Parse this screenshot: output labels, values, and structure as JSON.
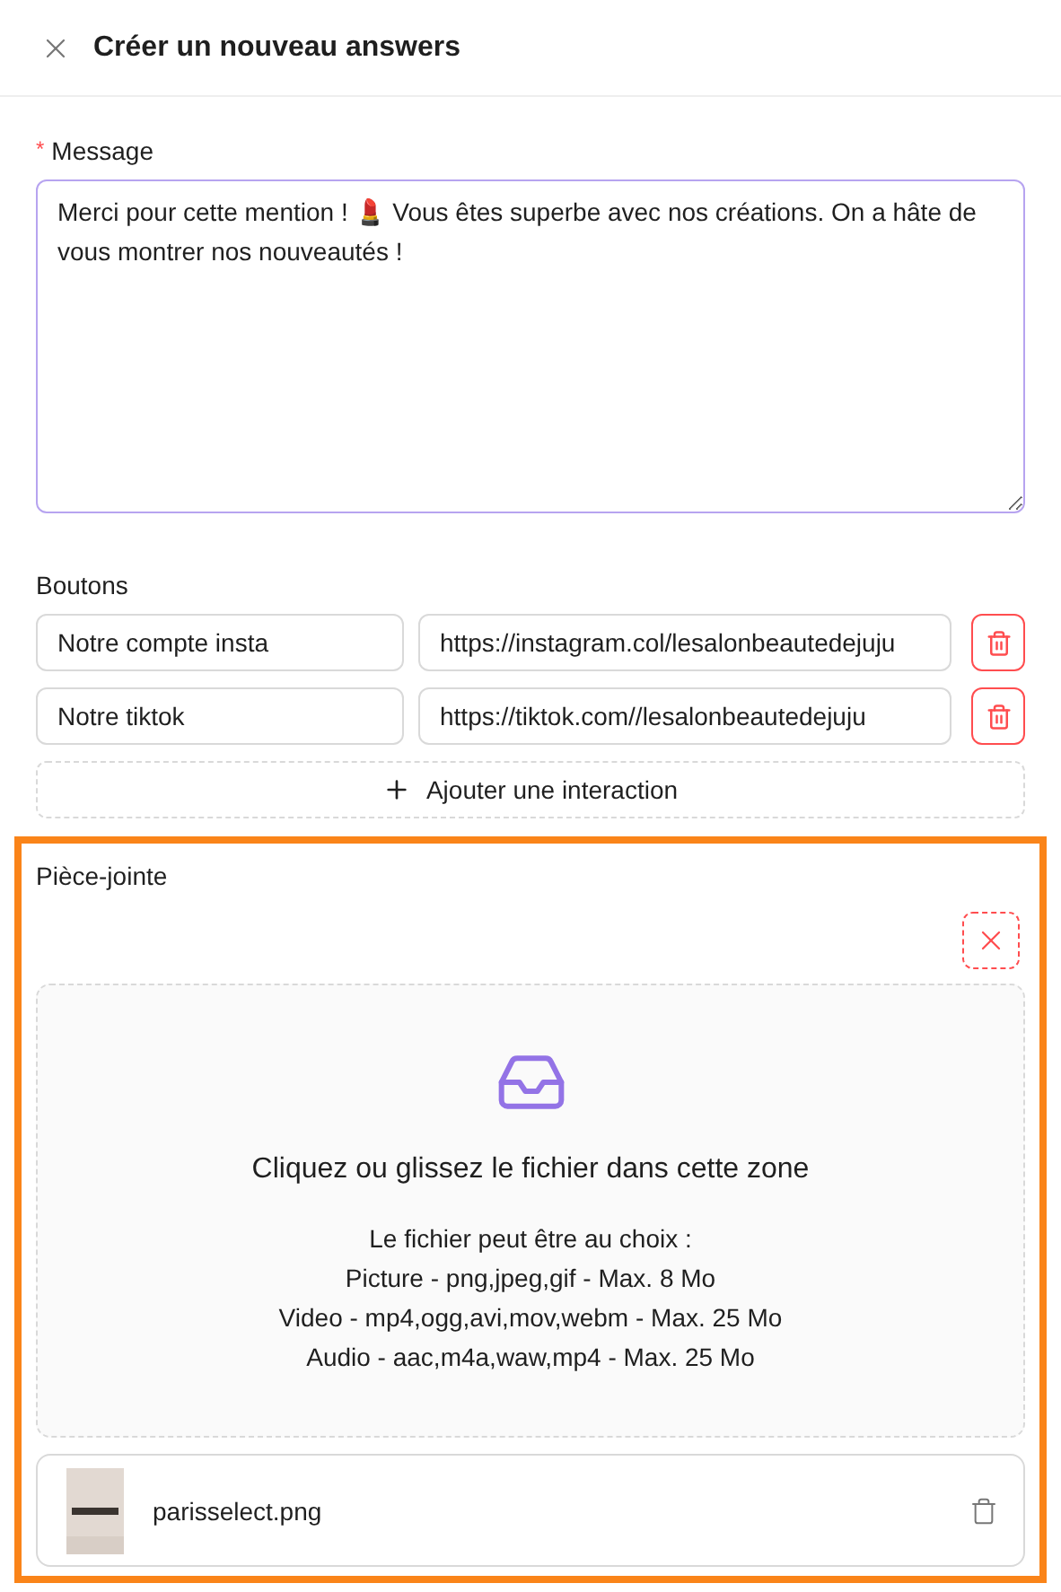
{
  "header": {
    "title": "Créer un nouveau answers"
  },
  "message": {
    "label": "Message",
    "required": true,
    "required_mark": "*",
    "value": "Merci pour cette mention ! 💄 Vous êtes superbe avec nos créations. On a hâte de vous montrer nos nouveautés !"
  },
  "buttons": {
    "label": "Boutons",
    "rows": [
      {
        "name": "Notre compte insta",
        "url": "https://instagram.col/lesalonbeautedejuju"
      },
      {
        "name": "Notre tiktok",
        "url": "https://tiktok.com//lesalonbeautedejuju"
      }
    ],
    "add_label": "Ajouter une interaction"
  },
  "attachment": {
    "label": "Pièce-jointe",
    "highlighted": true,
    "dropzone": {
      "title": "Cliquez ou glissez le fichier dans cette zone",
      "lines": [
        "Le fichier peut être au choix :",
        "Picture - png,jpeg,gif - Max. 8 Mo",
        "Video - mp4,ogg,avi,mov,webm - Max. 25 Mo",
        "Audio - aac,m4a,waw,mp4 - Max. 25 Mo"
      ]
    },
    "files": [
      {
        "name": "parisselect.png"
      }
    ]
  }
}
